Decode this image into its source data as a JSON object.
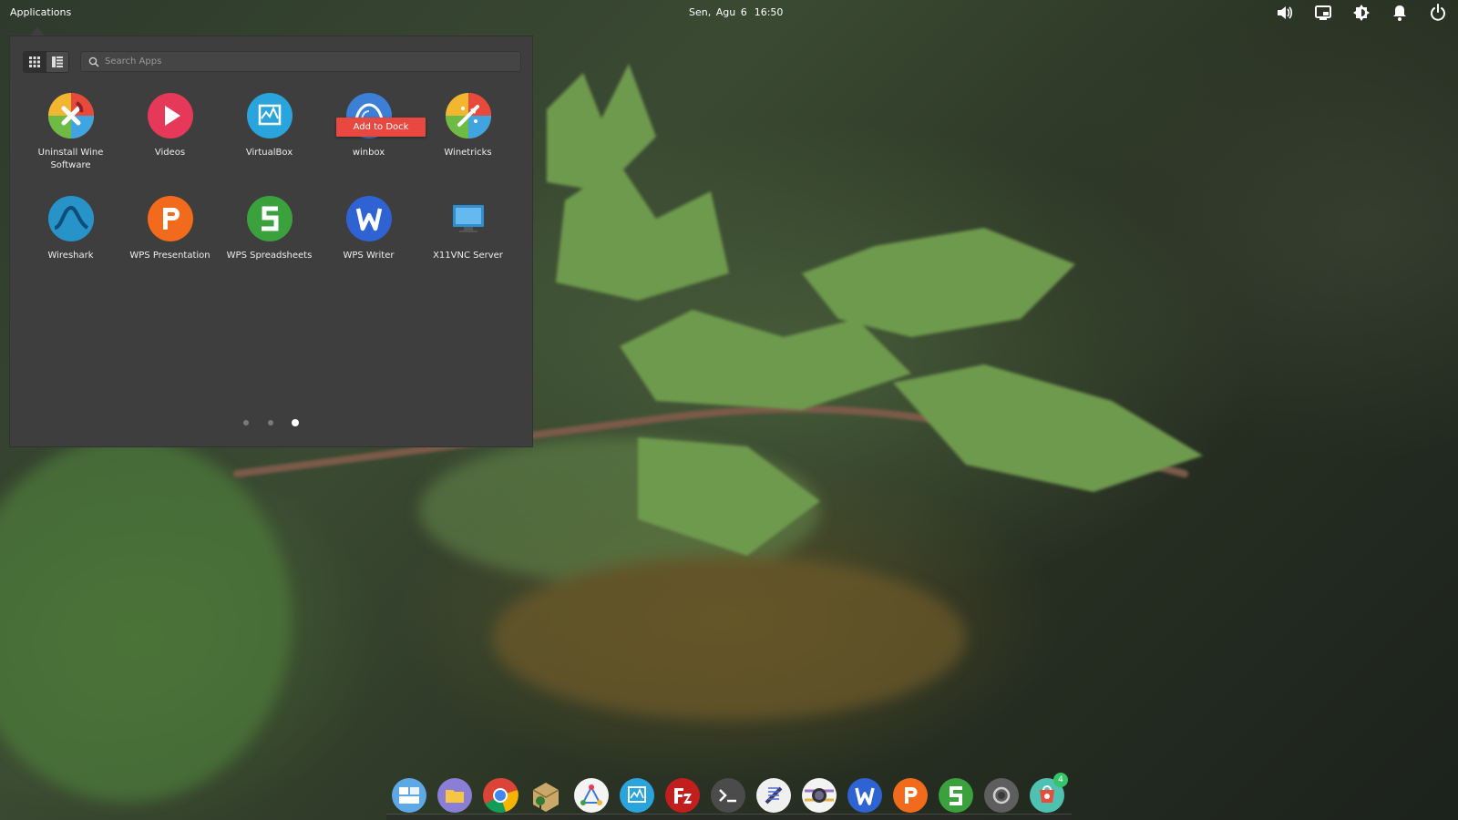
{
  "panel": {
    "applications_label": "Applications",
    "date": "Sen, Agu 6",
    "time": "16:50",
    "tray_icons": [
      "volume-icon",
      "display-icon",
      "brightness-icon",
      "notifications-icon",
      "power-icon"
    ]
  },
  "menu": {
    "search_placeholder": "Search Apps",
    "view_modes": [
      "grid-view",
      "category-view"
    ],
    "active_view": "grid-view",
    "apps": [
      {
        "label": "Uninstall Wine Software",
        "icon": "uninstall-wine-icon"
      },
      {
        "label": "Videos",
        "icon": "videos-icon"
      },
      {
        "label": "VirtualBox",
        "icon": "virtualbox-icon"
      },
      {
        "label": "winbox",
        "icon": "winbox-icon"
      },
      {
        "label": "Winetricks",
        "icon": "winetricks-icon"
      },
      {
        "label": "Wireshark",
        "icon": "wireshark-icon"
      },
      {
        "label": "WPS Presentation",
        "icon": "wps-presentation-icon"
      },
      {
        "label": "WPS Spreadsheets",
        "icon": "wps-spreadsheets-icon"
      },
      {
        "label": "WPS Writer",
        "icon": "wps-writer-icon"
      },
      {
        "label": "X11VNC Server",
        "icon": "x11vnc-icon"
      }
    ],
    "context_action": "Add to Dock",
    "pages": 3,
    "current_page": 3
  },
  "dock": {
    "items": [
      "multitasking-view-icon",
      "files-icon",
      "chrome-icon",
      "archive-manager-icon",
      "graph-app-icon",
      "virtualbox-icon",
      "filezilla-icon",
      "terminal-icon",
      "screenshot-tool-icon",
      "camera-icon",
      "wps-writer-icon",
      "wps-presentation-icon",
      "wps-spreadsheets-icon",
      "settings-circle-icon",
      "appcenter-icon"
    ],
    "appcenter_badge": "4"
  },
  "colors": {
    "menu_bg": "#3e3e3e",
    "accent_red": "#e8483f"
  }
}
